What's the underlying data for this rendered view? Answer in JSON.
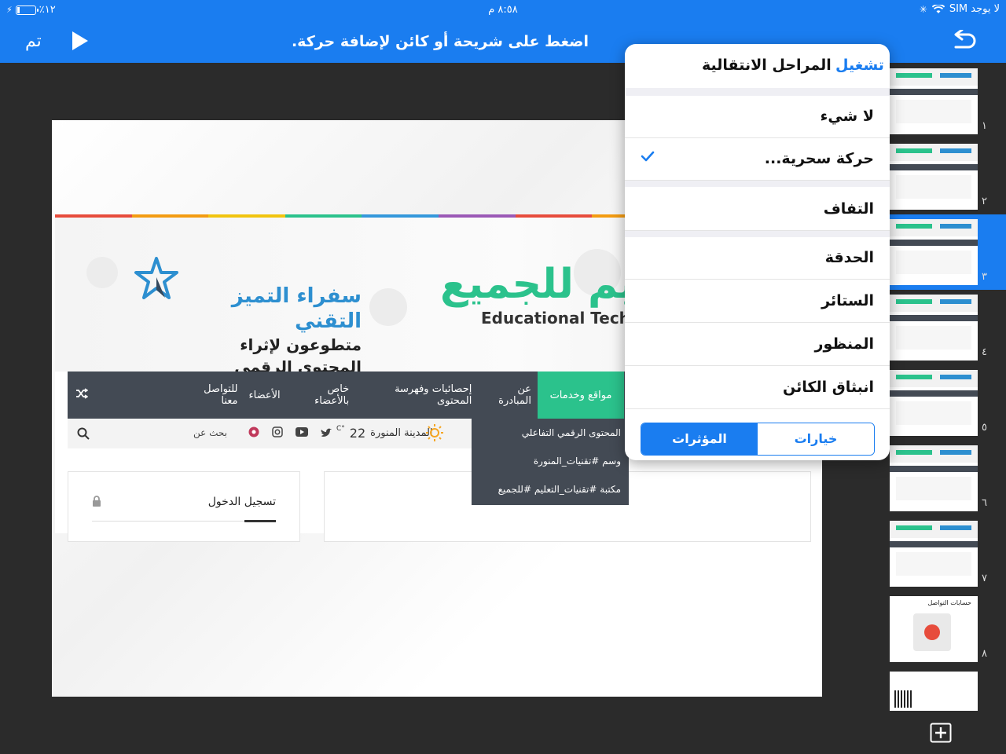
{
  "status_bar": {
    "carrier": "لا يوجد SIM",
    "time": "٨:٥٨ م",
    "battery": "٪١٢"
  },
  "toolbar": {
    "done_label": "تم",
    "hint": "اضغط على شريحة أو كائن لإضافة حركة."
  },
  "slide": {
    "brand_title_ar": "سفراء التميز التقني",
    "brand_subtitle_ar": "متطوعون لإثراء المحتوى الرقمي",
    "edu_title_ar": "تعليم للجميع",
    "edu_title_en": "Educational Techn",
    "nav_active": "مواقع وخدمات",
    "nav_items": [
      "عن المبادرة",
      "إحصائيات وفهرسة المحتوى",
      "خاص بالأعضاء",
      "الأعضاء",
      "للتواصل معنا"
    ],
    "weather_city": "المدينة المنورة",
    "weather_temp": "22",
    "weather_unit": "°C",
    "search_label": "بحث عن",
    "dropdown_items": [
      "المحتوى الرقمي التفاعلي",
      "وسم #تقنيات_المنورة",
      "مكتبة #تقنيات_التعليم #للجميع"
    ],
    "login_title": "تسجيل الدخول"
  },
  "thumbnails": {
    "numbers": [
      "١",
      "٢",
      "٣",
      "٤",
      "٥",
      "٦",
      "٧",
      "٨"
    ],
    "selected_index": 3,
    "slide8_title": "حسابات التواصل"
  },
  "popover": {
    "play_label": "تشغيل",
    "title": "المراحل الانتقالية",
    "options": [
      {
        "label": "لا شيء",
        "checked": false
      },
      {
        "label": "حركة سحرية...",
        "checked": true
      },
      {
        "label": "التفاف",
        "checked": false
      },
      {
        "label": "الحدقة",
        "checked": false
      },
      {
        "label": "الستائر",
        "checked": false
      },
      {
        "label": "المنظور",
        "checked": false
      },
      {
        "label": "انبثاق الكائن",
        "checked": false
      }
    ],
    "tab_effects": "المؤثرات",
    "tab_options": "خيارات"
  },
  "colors": {
    "accent": "#1a7df0",
    "green": "#2bc28c",
    "nav": "#434a54",
    "rainbow": [
      "#e74c3c",
      "#f39c12",
      "#f1c40f",
      "#2bc28c",
      "#3498db",
      "#9b59b6",
      "#e74c3c",
      "#f39c12",
      "#1abc9c",
      "#3498db"
    ]
  }
}
